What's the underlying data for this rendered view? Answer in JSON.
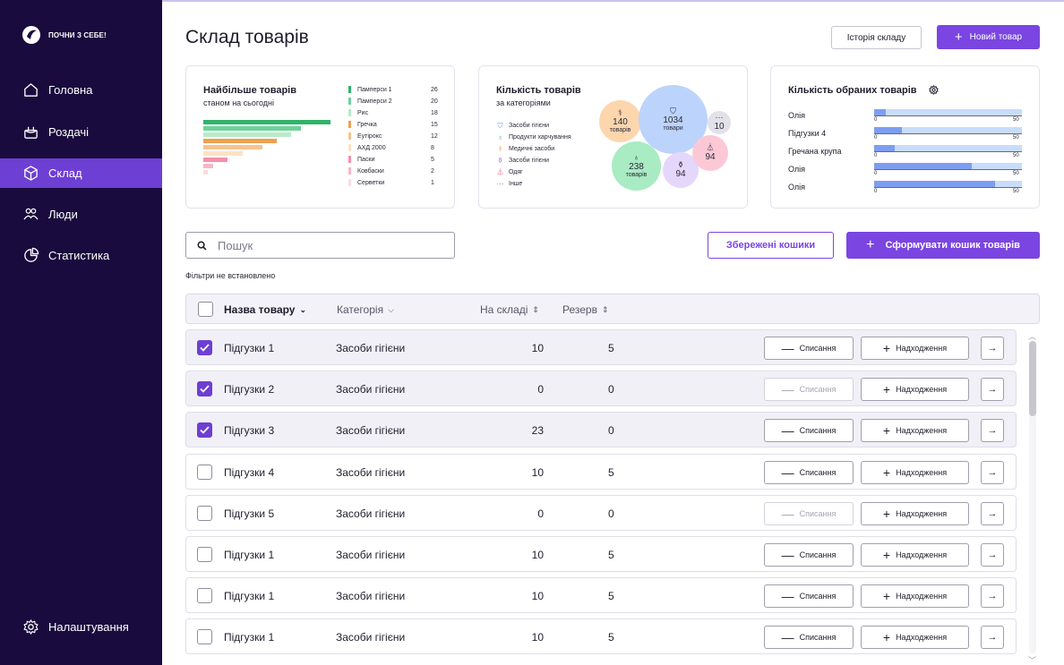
{
  "brand": {
    "name": "ПОЧНИ З СЕБЕ!"
  },
  "sidebar": {
    "items": [
      {
        "label": "Головна",
        "icon": "home-icon"
      },
      {
        "label": "Роздачі",
        "icon": "gift-icon"
      },
      {
        "label": "Склад",
        "icon": "box-icon",
        "active": true
      },
      {
        "label": "Люди",
        "icon": "people-icon"
      },
      {
        "label": "Статистика",
        "icon": "pie-chart-icon"
      }
    ],
    "settings": {
      "label": "Налаштування",
      "icon": "gear-icon"
    }
  },
  "header": {
    "title": "Склад товарів",
    "history_button": "Історія складу",
    "new_button": "Новий товар"
  },
  "colors": {
    "accent": "#7a45e0",
    "sidebar_bg": "#190b3d",
    "active_nav": "#6d3fd3"
  },
  "card_top": {
    "title": "Найбільше товарів",
    "subtitle": "станом на сьогодні",
    "items": [
      {
        "name": "Памперси 1",
        "value": 26,
        "color": "#2fb36a"
      },
      {
        "name": "Памперси 2",
        "value": 20,
        "color": "#6ed29a"
      },
      {
        "name": "Рис",
        "value": 18,
        "color": "#b6ecc9"
      },
      {
        "name": "Гречка",
        "value": 15,
        "color": "#f0a04e"
      },
      {
        "name": "Еутірокс",
        "value": 12,
        "color": "#f6c38f"
      },
      {
        "name": "АХД 2000",
        "value": 8,
        "color": "#fbe2c6"
      },
      {
        "name": "Паски",
        "value": 5,
        "color": "#f78fa8"
      },
      {
        "name": "Ковбаски",
        "value": 2,
        "color": "#f9b6c6"
      },
      {
        "name": "Серветки",
        "value": 1,
        "color": "#fcdbe3"
      }
    ]
  },
  "card_categories": {
    "title": "Кількість товарів",
    "subtitle": "за категоріями",
    "legend": [
      {
        "label": "Засоби гігієни",
        "icon": "diaper-icon",
        "symbol": "⛉",
        "color": "#6a8fe8"
      },
      {
        "label": "Продукти харчування",
        "icon": "apple-icon",
        "symbol": "♁",
        "color": "#2fb36a"
      },
      {
        "label": "Медичні засоби",
        "icon": "pills-icon",
        "symbol": "⚕",
        "color": "#f0a04e"
      },
      {
        "label": "Засоби гігієни",
        "icon": "bottle-icon",
        "symbol": "⚱",
        "color": "#a57be6"
      },
      {
        "label": "Одяг",
        "icon": "hanger-icon",
        "symbol": "⏃",
        "color": "#e8587a"
      },
      {
        "label": "Інше",
        "icon": "ellipsis-icon",
        "symbol": "···",
        "color": "#6b6879"
      }
    ],
    "bubbles": [
      {
        "value": "140",
        "label": "товарів",
        "symbol": "⚕",
        "color": "#fdd6ad"
      },
      {
        "value": "1034",
        "label": "товари",
        "symbol": "⛉",
        "color": "#bcd4fb"
      },
      {
        "value": "10",
        "label": "",
        "symbol": "···",
        "color": "#e2e1ea"
      },
      {
        "value": "238",
        "label": "товарів",
        "symbol": "♁",
        "color": "#a9ebc2"
      },
      {
        "value": "94",
        "label": "",
        "symbol": "⚱",
        "color": "#e4d7fb"
      },
      {
        "value": "94",
        "label": "",
        "symbol": "⏃",
        "color": "#fcc8d5"
      }
    ]
  },
  "card_selected": {
    "title": "Кількість обраних товарів",
    "axis_min": "0",
    "axis_max": "50",
    "items": [
      {
        "name": "Олія",
        "value": 4
      },
      {
        "name": "Підгузки 4",
        "value": 9.5
      },
      {
        "name": "Гречана крупа",
        "value": 7
      },
      {
        "name": "Олія",
        "value": 33
      },
      {
        "name": "Олія",
        "value": 41
      }
    ]
  },
  "search": {
    "placeholder": "Пошук"
  },
  "saved_carts_button": "Збережені кошики",
  "form_cart_button": "Сформувати кошик товарів",
  "filters_note": "Фільтри не встановлено",
  "table": {
    "columns": {
      "name": "Назва товару",
      "category": "Категорія",
      "stock": "На складі",
      "reserve": "Резерв"
    },
    "writeoff_label": "Списання",
    "receipt_label": "Надходження",
    "rows": [
      {
        "name": "Підгузки 1",
        "category": "Засоби гігієни",
        "stock": "10",
        "reserve": "5",
        "checked": true,
        "writeoff_disabled": false
      },
      {
        "name": "Підгузки 2",
        "category": "Засоби гігієни",
        "stock": "0",
        "reserve": "0",
        "checked": true,
        "writeoff_disabled": true
      },
      {
        "name": "Підгузки 3",
        "category": "Засоби гігієни",
        "stock": "23",
        "reserve": "0",
        "checked": true,
        "writeoff_disabled": false
      },
      {
        "name": "Підгузки 4",
        "category": "Засоби гігієни",
        "stock": "10",
        "reserve": "5",
        "checked": false,
        "writeoff_disabled": false
      },
      {
        "name": "Підгузки 5",
        "category": "Засоби гігієни",
        "stock": "0",
        "reserve": "0",
        "checked": false,
        "writeoff_disabled": true
      },
      {
        "name": "Підгузки 1",
        "category": "Засоби гігієни",
        "stock": "10",
        "reserve": "5",
        "checked": false,
        "writeoff_disabled": false
      },
      {
        "name": "Підгузки 1",
        "category": "Засоби гігієни",
        "stock": "10",
        "reserve": "5",
        "checked": false,
        "writeoff_disabled": false
      },
      {
        "name": "Підгузки 1",
        "category": "Засоби гігієни",
        "stock": "10",
        "reserve": "5",
        "checked": false,
        "writeoff_disabled": false
      }
    ]
  }
}
